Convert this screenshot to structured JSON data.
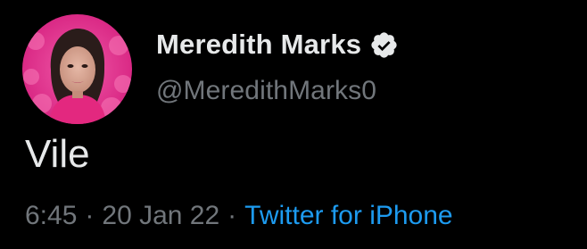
{
  "tweet": {
    "author": {
      "display_name": "Meredith Marks",
      "handle": "@MeredithMarks0",
      "verified": true,
      "avatar_icon": "profile-photo"
    },
    "text": "Vile",
    "meta": {
      "time": "6:45",
      "date": "20 Jan 22",
      "separator": "·",
      "source": "Twitter for iPhone"
    }
  },
  "colors": {
    "background": "#000000",
    "primary_text": "#e7e9ea",
    "secondary_text": "#71767b",
    "link": "#1d9bf0",
    "avatar_ring": "#e8358f"
  }
}
